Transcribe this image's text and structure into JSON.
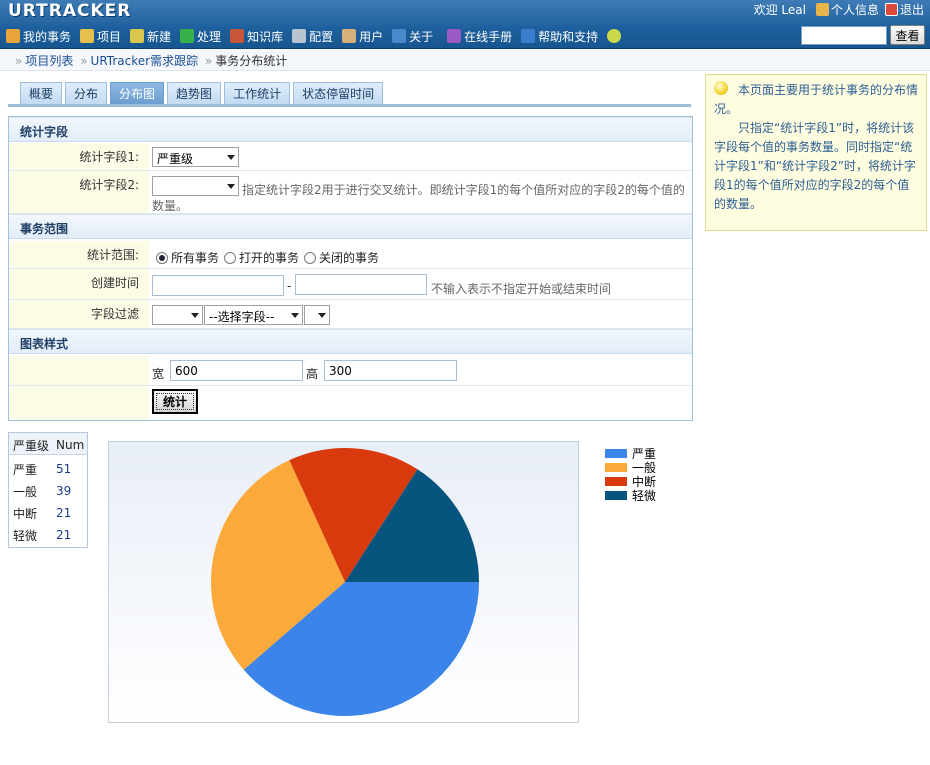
{
  "app": {
    "logo": "URTRACKER"
  },
  "user": {
    "welcome": "欢迎 Leal",
    "profile": "个人信息",
    "logout": "退出"
  },
  "nav": [
    {
      "label": "我的事务",
      "icon": "home-icon",
      "color": "#e8a33a"
    },
    {
      "label": "项目",
      "icon": "database-icon",
      "color": "#e6c04a"
    },
    {
      "label": "新建",
      "icon": "new-form-icon",
      "color": "#d9c64a"
    },
    {
      "label": "处理",
      "icon": "check-icon",
      "color": "#37b24a"
    },
    {
      "label": "知识库",
      "icon": "books-icon",
      "color": "#c8563a"
    },
    {
      "label": "配置",
      "icon": "gear-icon",
      "color": "#b8c4d0"
    },
    {
      "label": "用户",
      "icon": "users-icon",
      "color": "#d6b07a"
    },
    {
      "label": "关于",
      "icon": "info-icon",
      "color": "#4a88cc"
    },
    {
      "label": "在线手册",
      "icon": "manual-icon",
      "color": "#9a5ac4"
    },
    {
      "label": "帮助和支持",
      "icon": "help-icon",
      "color": "#3a7ed0"
    }
  ],
  "search": {
    "placeholder": "",
    "button": "查看"
  },
  "breadcrumb": {
    "items": [
      "项目列表",
      "URTracker需求跟踪",
      "事务分布统计"
    ]
  },
  "tabs": [
    {
      "label": "概要",
      "active": false
    },
    {
      "label": "分布",
      "active": false
    },
    {
      "label": "分布图",
      "active": true
    },
    {
      "label": "趋势图",
      "active": false
    },
    {
      "label": "工作统计",
      "active": false
    },
    {
      "label": "状态停留时间",
      "active": false
    }
  ],
  "form": {
    "section_fields": "统计字段",
    "field1_label": "统计字段1:",
    "field1_value": "严重级",
    "field2_label": "统计字段2:",
    "field2_value": "",
    "field2_hint_1": "指定统计字段2用于进行交叉统计。即统计字段1的每个值所对应的字段2的每个值的",
    "field2_hint_2": "数量。",
    "section_scope": "事务范围",
    "scope_label": "统计范围:",
    "scope_all": "所有事务",
    "scope_open": "打开的事务",
    "scope_closed": "关闭的事务",
    "scope_selected": "all",
    "created_label": "创建时间",
    "date_sep": "-",
    "date_hint": "不输入表示不指定开始或结束时间",
    "filter_label": "字段过滤",
    "filter_op": "",
    "filter_field": "--选择字段--",
    "filter_value": "",
    "section_style": "图表样式",
    "width_label": "宽",
    "width_value": "600",
    "height_label": "高",
    "height_value": "300",
    "submit": "统计"
  },
  "help": {
    "p1": "本页面主要用于统计事务的分布情况。",
    "p2": "只指定“统计字段1”时，将统计该字段每个值的事务数量。同时指定“统计字段1”和“统计字段2”时，将统计字段1的每个值所对应的字段2的每个值的数量。"
  },
  "summary": {
    "headers": [
      "严重级",
      "Num"
    ],
    "rows": [
      {
        "name": "严重",
        "num": "51"
      },
      {
        "name": "一般",
        "num": "39"
      },
      {
        "name": "中断",
        "num": "21"
      },
      {
        "name": "轻微",
        "num": "21"
      }
    ]
  },
  "chart_data": {
    "type": "pie",
    "categories": [
      "严重",
      "一般",
      "中断",
      "轻微"
    ],
    "values": [
      51,
      39,
      21,
      21
    ],
    "colors": [
      "#3a84ea",
      "#fba93a",
      "#d83a0e",
      "#07557f"
    ],
    "legend": "right"
  }
}
